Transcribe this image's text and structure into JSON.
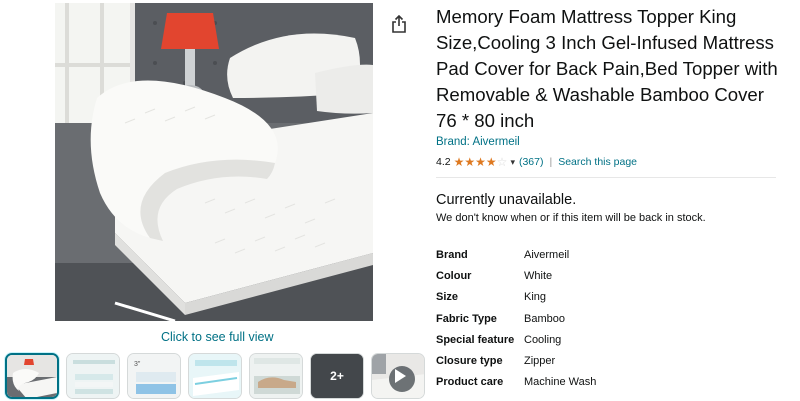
{
  "product": {
    "title": "Memory Foam Mattress Topper King Size,Cooling 3 Inch Gel-Infused Mattress Pad Cover for Back Pain,Bed Topper with Removable & Washable Bamboo Cover 76 * 80 inch",
    "brand_link": "Brand: Aivermeil",
    "rating": "4.2",
    "rating_stars": 4.2,
    "review_count": "(367)",
    "search_page_link": "Search this page"
  },
  "availability": {
    "status": "Currently unavailable.",
    "note": "We don't know when or if this item will be back in stock."
  },
  "specs": [
    {
      "key": "Brand",
      "value": "Aivermeil"
    },
    {
      "key": "Colour",
      "value": "White"
    },
    {
      "key": "Size",
      "value": "King"
    },
    {
      "key": "Fabric Type",
      "value": "Bamboo"
    },
    {
      "key": "Special feature",
      "value": "Cooling"
    },
    {
      "key": "Closure type",
      "value": "Zipper"
    },
    {
      "key": "Product care",
      "value": "Machine Wash"
    }
  ],
  "gallery": {
    "full_view_label": "Click to see full view",
    "more_label": "2+",
    "thumbnails": [
      "main-topper",
      "layers-diagram",
      "three-inch-detail",
      "cooling-gel",
      "bedroom-lifestyle",
      "more-images",
      "video"
    ]
  },
  "icons": {
    "share": "share-icon",
    "play": "play-icon",
    "chevron": "chevron-down-icon"
  },
  "colors": {
    "link": "#007185",
    "star": "#DE7921",
    "text": "#0F1111"
  }
}
